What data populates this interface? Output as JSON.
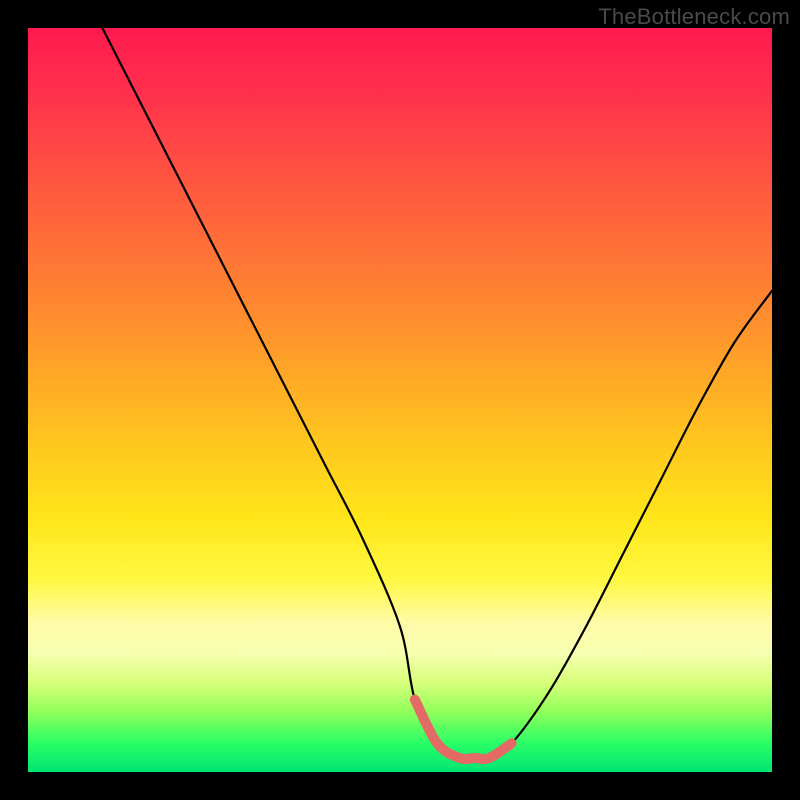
{
  "watermark": "TheBottleneck.com",
  "chart_data": {
    "type": "line",
    "title": "",
    "xlabel": "",
    "ylabel": "",
    "xlim": [
      0,
      100
    ],
    "ylim": [
      0,
      100
    ],
    "series": [
      {
        "name": "bottleneck-curve",
        "color": "#000000",
        "x": [
          10,
          15,
          20,
          25,
          30,
          35,
          40,
          45,
          50,
          52,
          55,
          58,
          60,
          62,
          65,
          70,
          75,
          80,
          85,
          90,
          95,
          100
        ],
        "values": [
          100,
          90,
          80,
          70,
          60,
          50,
          40,
          30,
          18,
          8,
          2,
          0,
          0,
          0,
          2,
          9,
          18,
          28,
          38,
          48,
          57,
          64
        ]
      },
      {
        "name": "flat-bottom-highlight",
        "color": "#e46a66",
        "x": [
          52,
          55,
          58,
          60,
          62,
          65
        ],
        "values": [
          8,
          2,
          0,
          0,
          0,
          2
        ]
      }
    ],
    "grid": false,
    "legend": false
  }
}
